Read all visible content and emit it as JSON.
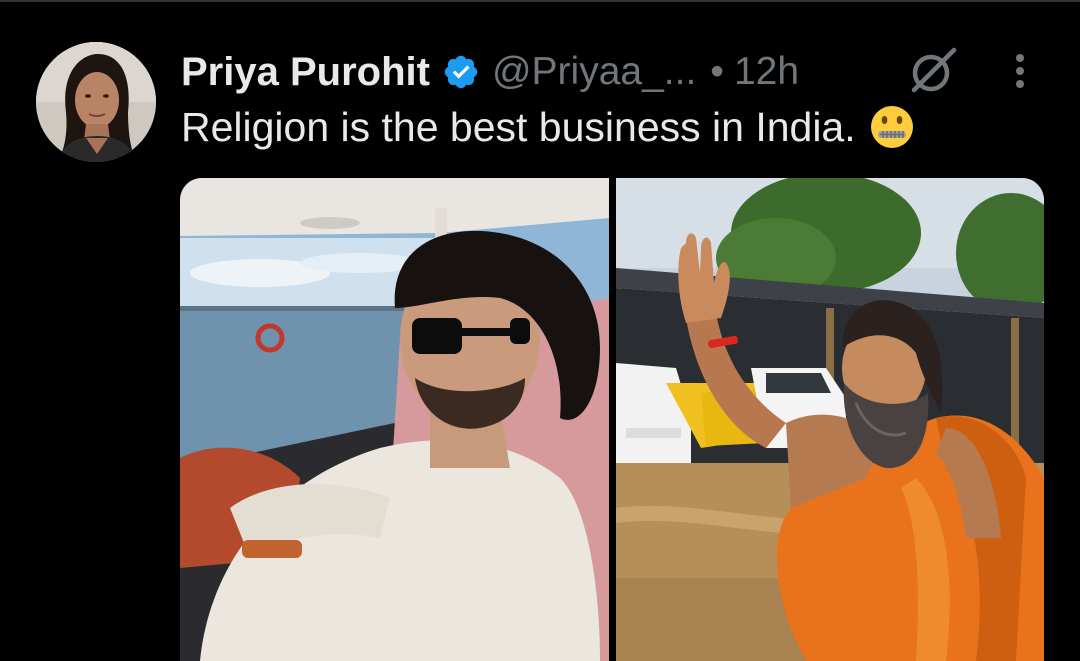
{
  "tweet": {
    "author_name": "Priya Purohit",
    "handle": "@Priyaa_...",
    "separator": "•",
    "time": "12h",
    "text": "Religion is the best business in India.",
    "emoji": "zipper-mouth-face"
  },
  "icons": {
    "verified": "verified-badge-icon",
    "grok": "grok-icon",
    "more": "more-options-icon"
  },
  "colors": {
    "background": "#000000",
    "primary_text": "#e7e9ea",
    "secondary_text": "#71767b",
    "verified_blue": "#1d9bf0"
  }
}
